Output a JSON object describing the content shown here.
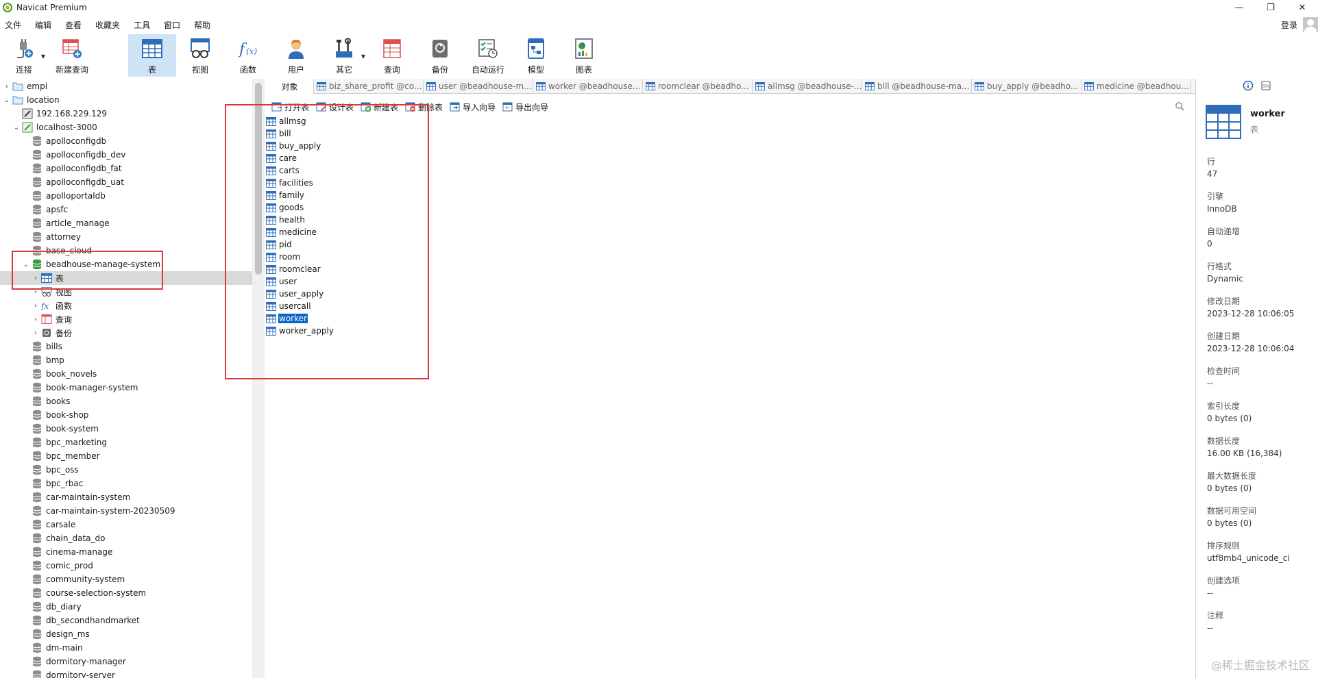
{
  "window": {
    "title": "Navicat Premium"
  },
  "menu": [
    "文件",
    "编辑",
    "查看",
    "收藏夹",
    "工具",
    "窗口",
    "帮助"
  ],
  "login": {
    "label": "登录"
  },
  "toolbar": [
    {
      "label": "连接",
      "icon": "plug-icon",
      "drop": true
    },
    {
      "label": "新建查询",
      "icon": "new-query-icon",
      "drop": false
    },
    {
      "label": "表",
      "icon": "table-icon",
      "drop": false,
      "active": true
    },
    {
      "label": "视图",
      "icon": "view-icon",
      "drop": false
    },
    {
      "label": "函数",
      "icon": "function-icon",
      "drop": false
    },
    {
      "label": "用户",
      "icon": "user-icon",
      "drop": false
    },
    {
      "label": "其它",
      "icon": "tools-icon",
      "drop": true
    },
    {
      "label": "查询",
      "icon": "query-icon",
      "drop": false
    },
    {
      "label": "备份",
      "icon": "backup-icon",
      "drop": false
    },
    {
      "label": "自动运行",
      "icon": "autorun-icon",
      "drop": false
    },
    {
      "label": "模型",
      "icon": "model-icon",
      "drop": false
    },
    {
      "label": "图表",
      "icon": "chart-icon",
      "drop": false
    }
  ],
  "tree": [
    {
      "label": "empi",
      "type": "folder",
      "indent": 0,
      "twisty": ">"
    },
    {
      "label": "location",
      "type": "folder",
      "indent": 0,
      "twisty": "v"
    },
    {
      "label": "192.168.229.129",
      "type": "conn-off",
      "indent": 1,
      "twisty": ""
    },
    {
      "label": "localhost-3000",
      "type": "conn-on",
      "indent": 1,
      "twisty": "v"
    },
    {
      "label": "apolloconfigdb",
      "type": "db",
      "indent": 2,
      "twisty": ""
    },
    {
      "label": "apolloconfigdb_dev",
      "type": "db",
      "indent": 2,
      "twisty": ""
    },
    {
      "label": "apolloconfigdb_fat",
      "type": "db",
      "indent": 2,
      "twisty": ""
    },
    {
      "label": "apolloconfigdb_uat",
      "type": "db",
      "indent": 2,
      "twisty": ""
    },
    {
      "label": "apolloportaldb",
      "type": "db",
      "indent": 2,
      "twisty": ""
    },
    {
      "label": "apsfc",
      "type": "db",
      "indent": 2,
      "twisty": ""
    },
    {
      "label": "article_manage",
      "type": "db",
      "indent": 2,
      "twisty": ""
    },
    {
      "label": "attorney",
      "type": "db",
      "indent": 2,
      "twisty": ""
    },
    {
      "label": "base_cloud",
      "type": "db",
      "indent": 2,
      "twisty": ""
    },
    {
      "label": "beadhouse-manage-system",
      "type": "db-open",
      "indent": 2,
      "twisty": "v"
    },
    {
      "label": "表",
      "type": "tables",
      "indent": 3,
      "twisty": ">",
      "selected": true
    },
    {
      "label": "视图",
      "type": "views",
      "indent": 3,
      "twisty": ">"
    },
    {
      "label": "函数",
      "type": "funcs",
      "indent": 3,
      "twisty": ">"
    },
    {
      "label": "查询",
      "type": "queries",
      "indent": 3,
      "twisty": ">"
    },
    {
      "label": "备份",
      "type": "backups",
      "indent": 3,
      "twisty": ">"
    },
    {
      "label": "bills",
      "type": "db",
      "indent": 2,
      "twisty": ""
    },
    {
      "label": "bmp",
      "type": "db",
      "indent": 2,
      "twisty": ""
    },
    {
      "label": "book_novels",
      "type": "db",
      "indent": 2,
      "twisty": ""
    },
    {
      "label": "book-manager-system",
      "type": "db",
      "indent": 2,
      "twisty": ""
    },
    {
      "label": "books",
      "type": "db",
      "indent": 2,
      "twisty": ""
    },
    {
      "label": "book-shop",
      "type": "db",
      "indent": 2,
      "twisty": ""
    },
    {
      "label": "book-system",
      "type": "db",
      "indent": 2,
      "twisty": ""
    },
    {
      "label": "bpc_marketing",
      "type": "db",
      "indent": 2,
      "twisty": ""
    },
    {
      "label": "bpc_member",
      "type": "db",
      "indent": 2,
      "twisty": ""
    },
    {
      "label": "bpc_oss",
      "type": "db",
      "indent": 2,
      "twisty": ""
    },
    {
      "label": "bpc_rbac",
      "type": "db",
      "indent": 2,
      "twisty": ""
    },
    {
      "label": "car-maintain-system",
      "type": "db",
      "indent": 2,
      "twisty": ""
    },
    {
      "label": "car-maintain-system-20230509",
      "type": "db",
      "indent": 2,
      "twisty": ""
    },
    {
      "label": "carsale",
      "type": "db",
      "indent": 2,
      "twisty": ""
    },
    {
      "label": "chain_data_do",
      "type": "db",
      "indent": 2,
      "twisty": ""
    },
    {
      "label": "cinema-manage",
      "type": "db",
      "indent": 2,
      "twisty": ""
    },
    {
      "label": "comic_prod",
      "type": "db",
      "indent": 2,
      "twisty": ""
    },
    {
      "label": "community-system",
      "type": "db",
      "indent": 2,
      "twisty": ""
    },
    {
      "label": "course-selection-system",
      "type": "db",
      "indent": 2,
      "twisty": ""
    },
    {
      "label": "db_diary",
      "type": "db",
      "indent": 2,
      "twisty": ""
    },
    {
      "label": "db_secondhandmarket",
      "type": "db",
      "indent": 2,
      "twisty": ""
    },
    {
      "label": "design_ms",
      "type": "db",
      "indent": 2,
      "twisty": ""
    },
    {
      "label": "dm-main",
      "type": "db",
      "indent": 2,
      "twisty": ""
    },
    {
      "label": "dormitory-manager",
      "type": "db",
      "indent": 2,
      "twisty": ""
    },
    {
      "label": "dormitory-server",
      "type": "db",
      "indent": 2,
      "twisty": ""
    }
  ],
  "tabs": [
    "对象",
    "biz_share_profit @co...",
    "user @beadhouse-m...",
    "worker @beadhouse...",
    "roomclear @beadho...",
    "allmsg @beadhouse-...",
    "bill @beadhouse-ma...",
    "buy_apply @beadho...",
    "medicine @beadhou..."
  ],
  "obj_toolbar": [
    "打开表",
    "设计表",
    "新建表",
    "删除表",
    "导入向导",
    "导出向导"
  ],
  "tables": [
    "allmsg",
    "bill",
    "buy_apply",
    "care",
    "carts",
    "facilities",
    "family",
    "goods",
    "health",
    "medicine",
    "pid",
    "room",
    "roomclear",
    "user",
    "user_apply",
    "usercall",
    "worker",
    "worker_apply"
  ],
  "selected_table": "worker",
  "info": {
    "name": "worker",
    "kind": "表",
    "fields": [
      {
        "k": "行",
        "v": "47"
      },
      {
        "k": "引擎",
        "v": "InnoDB"
      },
      {
        "k": "自动递增",
        "v": "0"
      },
      {
        "k": "行格式",
        "v": "Dynamic"
      },
      {
        "k": "修改日期",
        "v": "2023-12-28 10:06:05"
      },
      {
        "k": "创建日期",
        "v": "2023-12-28 10:06:04"
      },
      {
        "k": "检查时间",
        "v": "--"
      },
      {
        "k": "索引长度",
        "v": "0 bytes (0)"
      },
      {
        "k": "数据长度",
        "v": "16.00 KB (16,384)"
      },
      {
        "k": "最大数据长度",
        "v": "0 bytes (0)"
      },
      {
        "k": "数据可用空间",
        "v": "0 bytes (0)"
      },
      {
        "k": "排序规则",
        "v": "utf8mb4_unicode_ci"
      },
      {
        "k": "创建选项",
        "v": "--"
      },
      {
        "k": "注释",
        "v": "--"
      }
    ]
  },
  "watermark": "@稀土掘金技术社区",
  "colors": {
    "accent": "#0a64c8",
    "active_tool": "#cfe3f6",
    "annotation": "#d93a35"
  }
}
